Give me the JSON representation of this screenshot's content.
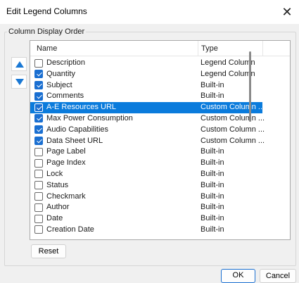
{
  "window": {
    "title": "Edit Legend Columns",
    "close_glyph": "✕"
  },
  "group": {
    "label": "Column Display Order"
  },
  "move": {
    "up_icon": "arrow-up-icon",
    "down_icon": "arrow-down-icon"
  },
  "colors": {
    "accent": "#1a6fd1",
    "selection": "#0a7bdc",
    "arrow": "#1a78d4"
  },
  "list": {
    "columns": [
      "Name",
      "Type"
    ],
    "rows": [
      {
        "name": "Description",
        "type": "Legend Column",
        "checked": false,
        "selected": false
      },
      {
        "name": "Quantity",
        "type": "Legend Column",
        "checked": true,
        "selected": false
      },
      {
        "name": "Subject",
        "type": "Built-in",
        "checked": true,
        "selected": false
      },
      {
        "name": "Comments",
        "type": "Built-in",
        "checked": true,
        "selected": false
      },
      {
        "name": "A-E Resources URL",
        "type": "Custom Column ...",
        "checked": true,
        "selected": true
      },
      {
        "name": "Max Power Consumption",
        "type": "Custom Column ...",
        "checked": true,
        "selected": false
      },
      {
        "name": "Audio Capabilities",
        "type": "Custom Column ...",
        "checked": true,
        "selected": false
      },
      {
        "name": "Data Sheet URL",
        "type": "Custom Column ...",
        "checked": true,
        "selected": false
      },
      {
        "name": "Page Label",
        "type": "Built-in",
        "checked": false,
        "selected": false
      },
      {
        "name": "Page Index",
        "type": "Built-in",
        "checked": false,
        "selected": false
      },
      {
        "name": "Lock",
        "type": "Built-in",
        "checked": false,
        "selected": false
      },
      {
        "name": "Status",
        "type": "Built-in",
        "checked": false,
        "selected": false
      },
      {
        "name": "Checkmark",
        "type": "Built-in",
        "checked": false,
        "selected": false
      },
      {
        "name": "Author",
        "type": "Built-in",
        "checked": false,
        "selected": false
      },
      {
        "name": "Date",
        "type": "Built-in",
        "checked": false,
        "selected": false
      },
      {
        "name": "Creation Date",
        "type": "Built-in",
        "checked": false,
        "selected": false
      },
      {
        "name": "",
        "type": "",
        "checked": false,
        "selected": false
      }
    ]
  },
  "buttons": {
    "reset": "Reset",
    "ok": "OK",
    "cancel": "Cancel"
  }
}
